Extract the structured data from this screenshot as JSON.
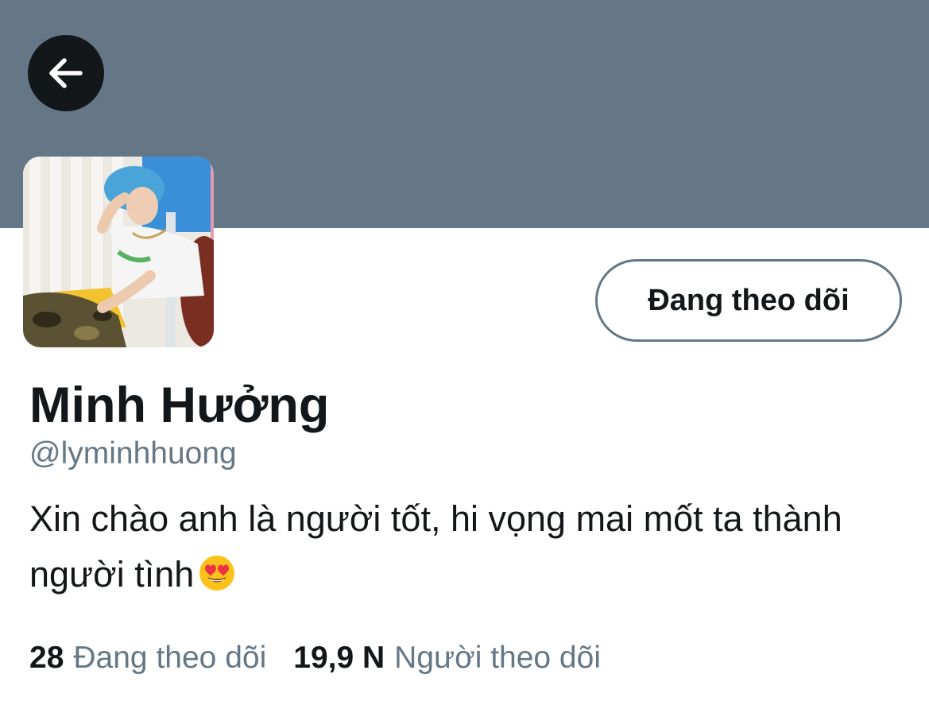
{
  "colors": {
    "banner": "#657786",
    "secondary_text": "#657786",
    "primary_text": "#14171a",
    "button_border": "#657786"
  },
  "header": {
    "back_icon": "arrow-left-icon"
  },
  "profile": {
    "follow_button_label": "Đang theo dõi",
    "display_name": "Minh Hưởng",
    "handle": "@lyminhhuong",
    "bio_text": "Xin chào anh là người tốt, hi vọng mai mốt ta thành người tình",
    "bio_emoji": "heart-eyes-emoji"
  },
  "stats": {
    "following_count": "28",
    "following_label": "Đang theo dõi",
    "followers_count": "19,9 N",
    "followers_label": "Người theo dõi"
  }
}
